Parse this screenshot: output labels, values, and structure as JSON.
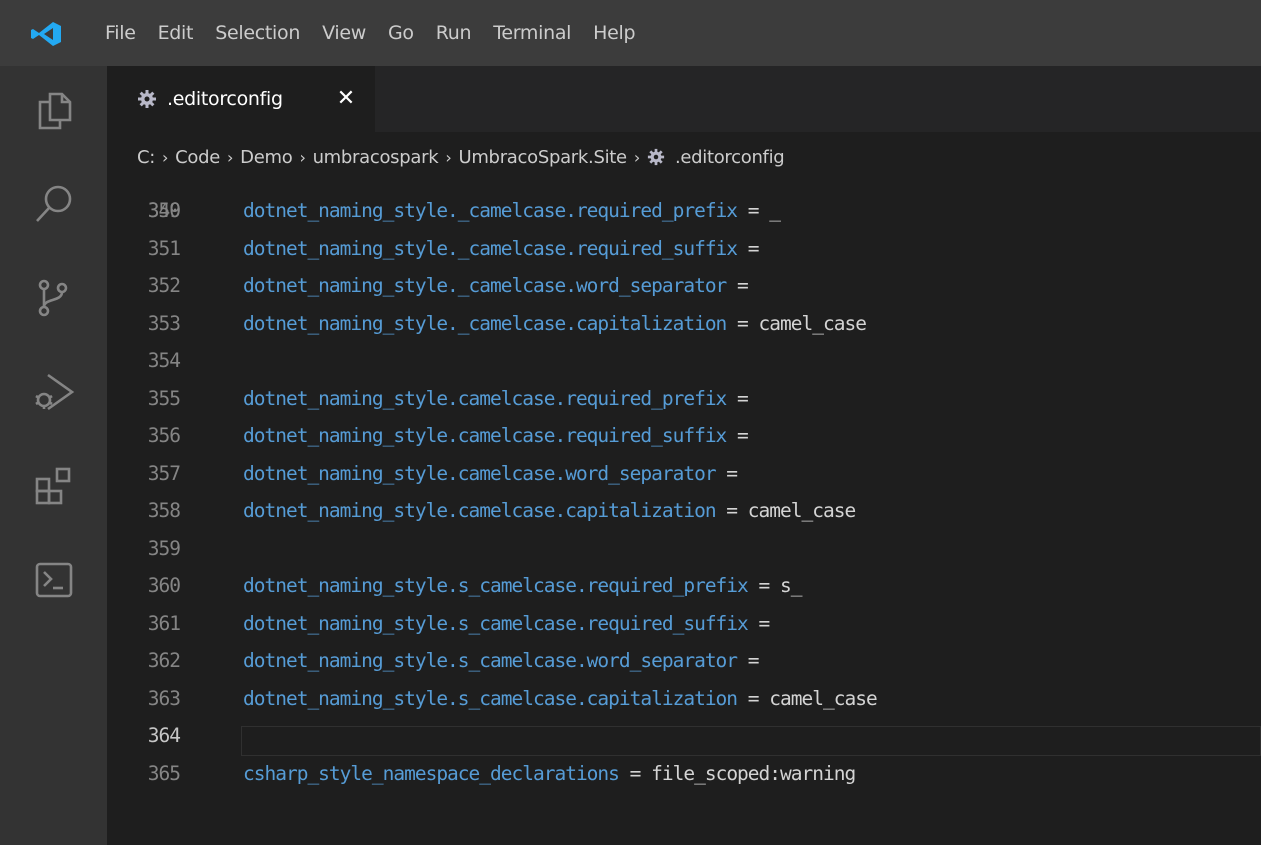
{
  "menu": [
    "File",
    "Edit",
    "Selection",
    "View",
    "Go",
    "Run",
    "Terminal",
    "Help"
  ],
  "activity_icons": [
    "explorer-icon",
    "search-icon",
    "source-control-icon",
    "run-debug-icon",
    "extensions-icon",
    "terminal-icon"
  ],
  "tab": {
    "label": ".editorconfig",
    "close": "✕"
  },
  "breadcrumb": [
    "C:",
    "Code",
    "Demo",
    "umbracospark",
    "UmbracoSpark.Site",
    ".editorconfig"
  ],
  "colors": {
    "keyword": "#569cd6",
    "text": "#d4d4d4",
    "line_number": "#858585",
    "accent": "#23a9f2"
  },
  "partial_line_number": "349",
  "current_line": "364",
  "lines": [
    {
      "no": "350",
      "key": "dotnet_naming_style._camelcase.required_prefix",
      "op": " = ",
      "val": "_"
    },
    {
      "no": "351",
      "key": "dotnet_naming_style._camelcase.required_suffix",
      "op": " =",
      "val": ""
    },
    {
      "no": "352",
      "key": "dotnet_naming_style._camelcase.word_separator",
      "op": " =",
      "val": ""
    },
    {
      "no": "353",
      "key": "dotnet_naming_style._camelcase.capitalization",
      "op": " = ",
      "val": "camel_case"
    },
    {
      "no": "354",
      "key": "",
      "op": "",
      "val": ""
    },
    {
      "no": "355",
      "key": "dotnet_naming_style.camelcase.required_prefix",
      "op": " =",
      "val": ""
    },
    {
      "no": "356",
      "key": "dotnet_naming_style.camelcase.required_suffix",
      "op": " =",
      "val": ""
    },
    {
      "no": "357",
      "key": "dotnet_naming_style.camelcase.word_separator",
      "op": " =",
      "val": ""
    },
    {
      "no": "358",
      "key": "dotnet_naming_style.camelcase.capitalization",
      "op": " = ",
      "val": "camel_case"
    },
    {
      "no": "359",
      "key": "",
      "op": "",
      "val": ""
    },
    {
      "no": "360",
      "key": "dotnet_naming_style.s_camelcase.required_prefix",
      "op": " = ",
      "val": "s_"
    },
    {
      "no": "361",
      "key": "dotnet_naming_style.s_camelcase.required_suffix",
      "op": " =",
      "val": ""
    },
    {
      "no": "362",
      "key": "dotnet_naming_style.s_camelcase.word_separator",
      "op": " =",
      "val": ""
    },
    {
      "no": "363",
      "key": "dotnet_naming_style.s_camelcase.capitalization",
      "op": " = ",
      "val": "camel_case"
    },
    {
      "no": "364",
      "key": "",
      "op": "",
      "val": ""
    },
    {
      "no": "365",
      "key": "csharp_style_namespace_declarations",
      "op": " = ",
      "val": "file_scoped:warning"
    }
  ]
}
